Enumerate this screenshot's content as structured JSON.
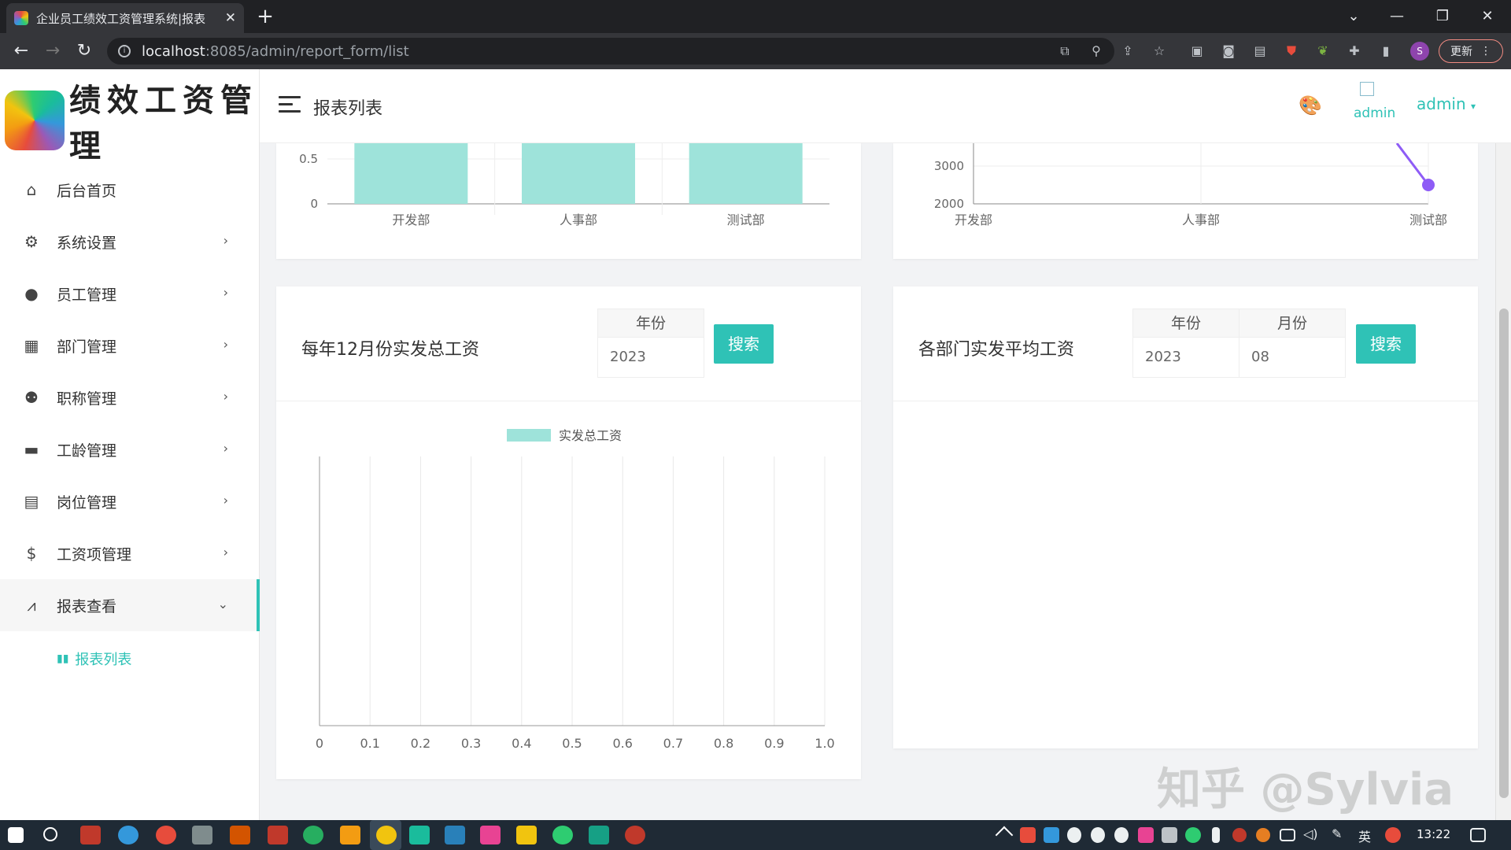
{
  "browser": {
    "tab_title": "企业员工绩效工资管理系统|报表",
    "url_host": "localhost",
    "url_path": ":8085/admin/report_form/list",
    "update_label": "更新",
    "profile_letter": "S"
  },
  "brand": {
    "name": "绩效工资管理"
  },
  "sidebar": {
    "items": [
      {
        "label": "后台首页",
        "icon": "home-icon"
      },
      {
        "label": "系统设置",
        "icon": "gear-icon"
      },
      {
        "label": "员工管理",
        "icon": "user-icon"
      },
      {
        "label": "部门管理",
        "icon": "calendar-icon"
      },
      {
        "label": "职称管理",
        "icon": "user-cog-icon"
      },
      {
        "label": "工龄管理",
        "icon": "wallet-icon"
      },
      {
        "label": "岗位管理",
        "icon": "list-icon"
      },
      {
        "label": "工资项管理",
        "icon": "dollar-icon"
      },
      {
        "label": "报表查看",
        "icon": "chart-icon"
      }
    ],
    "sub_items": [
      {
        "label": "报表列表",
        "icon": "bar-chart-icon"
      }
    ]
  },
  "header": {
    "page_title": "报表列表",
    "avatar_alt": "admin",
    "user": "admin"
  },
  "cards": {
    "annual": {
      "title": "每年12月份实发总工资",
      "year_label": "年份",
      "year_value": "2023",
      "search_label": "搜索"
    },
    "dept_avg": {
      "title": "各部门实发平均工资",
      "year_label": "年份",
      "year_value": "2023",
      "month_label": "月份",
      "month_value": "08",
      "search_label": "搜索"
    }
  },
  "watermark": "知乎 @Sylvia",
  "taskbar": {
    "time": "13:22",
    "ime": "英"
  },
  "chart_data": [
    {
      "type": "bar",
      "categories": [
        "开发部",
        "人事部",
        "测试部"
      ],
      "y_ticks_visible": [
        "0",
        "0.5"
      ],
      "partial": true,
      "color": "#9ee3da"
    },
    {
      "type": "line",
      "categories": [
        "开发部",
        "人事部",
        "测试部"
      ],
      "y_ticks_visible": [
        "2000",
        "3000"
      ],
      "partial": true,
      "color": "#8e5cf6"
    },
    {
      "type": "bar",
      "orientation": "horizontal",
      "legend": [
        "实发总工资"
      ],
      "x_ticks": [
        "0",
        "0.1",
        "0.2",
        "0.3",
        "0.4",
        "0.5",
        "0.6",
        "0.7",
        "0.8",
        "0.9",
        "1.0"
      ],
      "xlim": [
        0,
        1
      ],
      "values": [],
      "color": "#9ee3da"
    }
  ]
}
